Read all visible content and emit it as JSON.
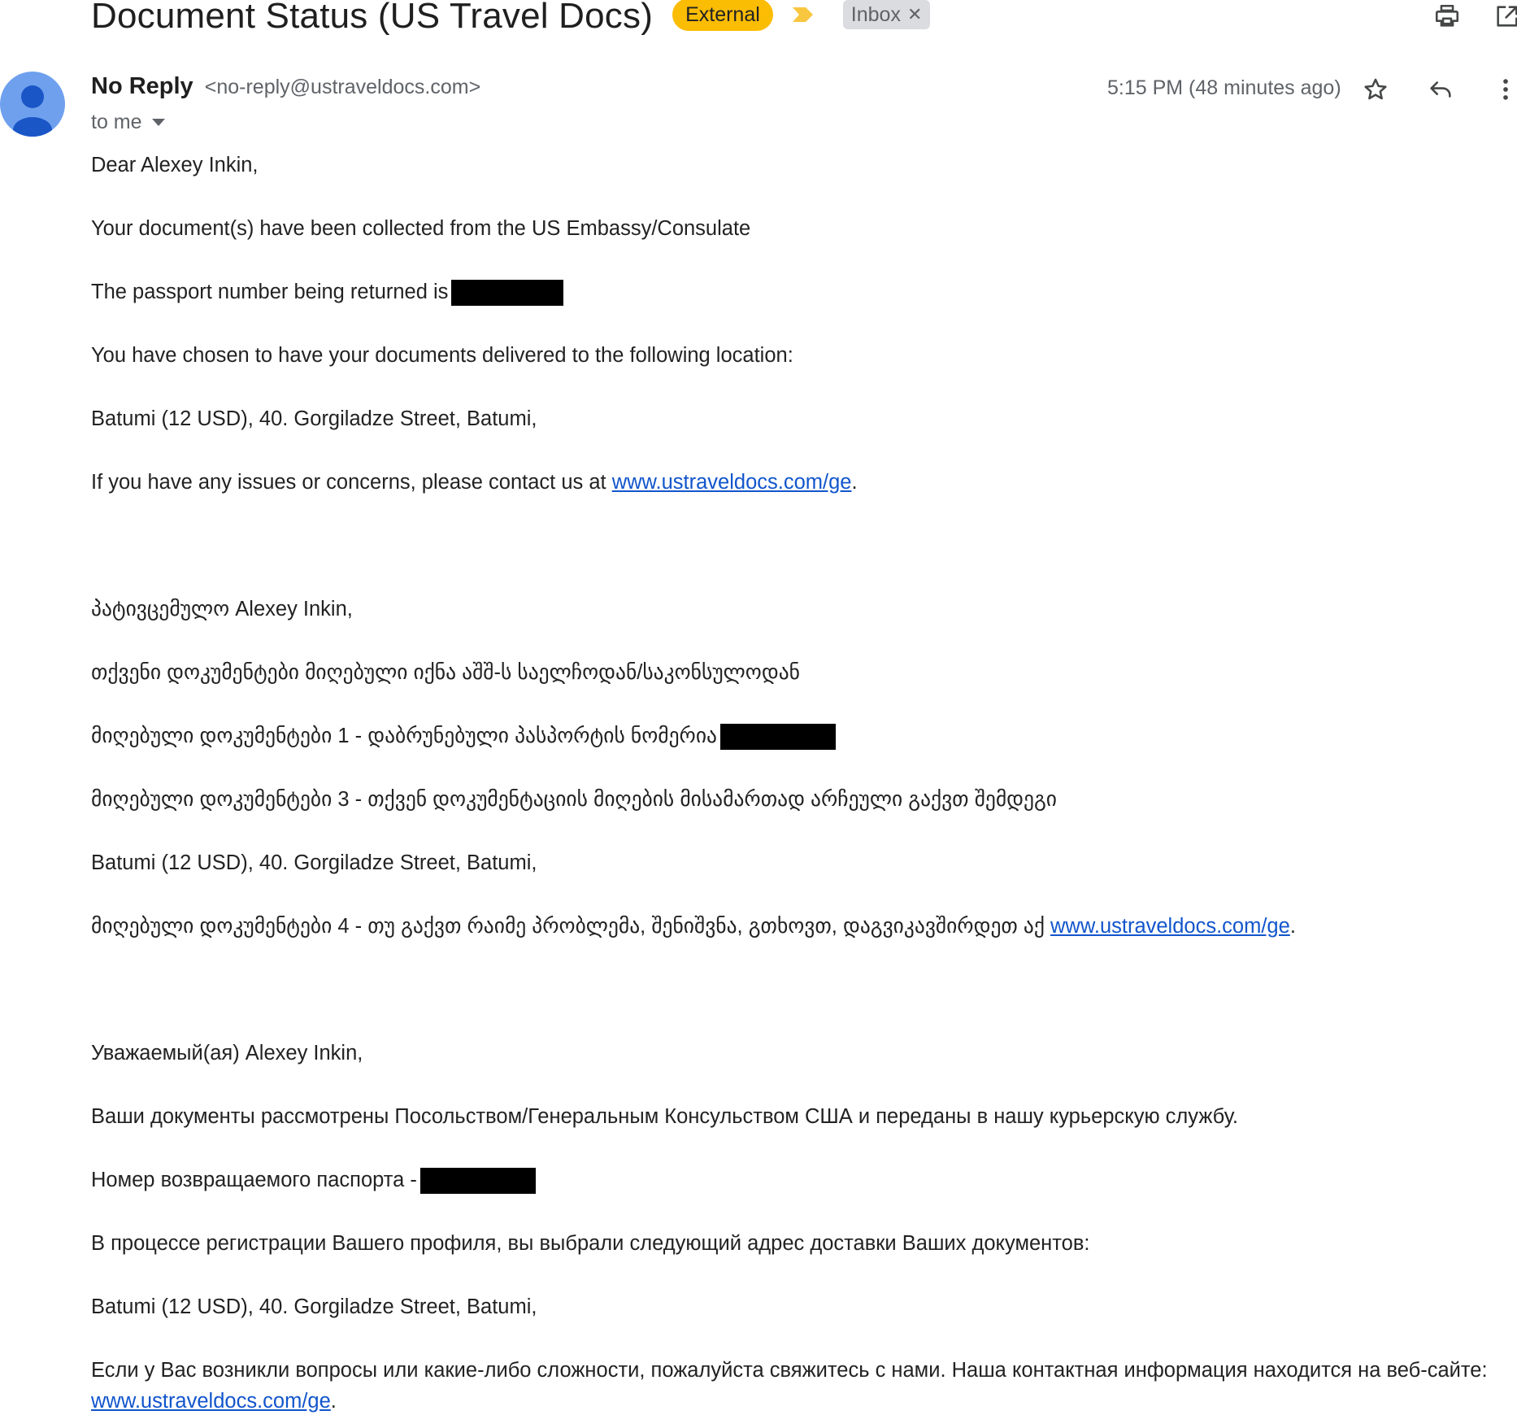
{
  "email": {
    "subject": "Document Status (US Travel Docs)",
    "labels": {
      "external": "External",
      "inbox": "Inbox"
    },
    "sender": {
      "name": "No Reply",
      "email": "<no-reply@ustraveldocs.com>"
    },
    "recipient_line": "to me",
    "timestamp": "5:15 PM (48 minutes ago)"
  },
  "icons": {
    "print": "print-icon",
    "popout": "open-in-new-window-icon",
    "star": "star-icon",
    "reply": "reply-icon",
    "more": "more-vertical-icon",
    "avatar": "default-avatar-icon",
    "importance": "importance-marker-icon",
    "remove_label": "close-icon",
    "expand": "chevron-down-icon"
  },
  "colors": {
    "external_label": "#fbbc04",
    "inbox_label": "#dadce0",
    "link": "#1155cc",
    "avatar": "#6ea0ee",
    "redaction": "#000000"
  },
  "body": {
    "en": {
      "greeting": "Dear Alexey Inkin,",
      "collected": "Your document(s) have been collected from the US Embassy/Consulate",
      "passport": "The passport number being returned is",
      "delivery_intro": "You have chosen to have your documents delivered to the following location:",
      "address": "Batumi (12 USD), 40. Gorgiladze Street, Batumi,",
      "contact_prefix": "If you have any issues or concerns, please contact us at ",
      "contact_link": "www.ustraveldocs.com/ge",
      "contact_suffix": "."
    },
    "ka": {
      "greeting": "პატივცემულო Alexey Inkin,",
      "collected": "თქვენი დოკუმენტები მიღებული იქნა აშშ-ს საელჩოდან/საკონსულოდან",
      "passport": "მიღებული დოკუმენტები 1 - დაბრუნებული პასპორტის ნომერია",
      "delivery_intro": "მიღებული დოკუმენტები 3 - თქვენ დოკუმენტაციის მიღების მისამართად არჩეული გაქვთ შემდეგი",
      "address": "Batumi (12 USD), 40. Gorgiladze Street, Batumi,",
      "contact_prefix": "მიღებული დოკუმენტები 4 - თუ გაქვთ რაიმე პრობლემა, შენიშვნა, გთხოვთ, დაგვიკავშირდეთ აქ ",
      "contact_link": "www.ustraveldocs.com/ge",
      "contact_suffix": "."
    },
    "ru": {
      "greeting": "Уважаемый(ая) Alexey Inkin,",
      "collected": "Ваши документы рассмотрены Посольством/Генеральным Консульством США и переданы в нашу курьерскую службу.",
      "passport": "Номер возвращаемого паспорта -",
      "delivery_intro": "В процессе регистрации Вашего профиля, вы выбрали следующий адрес доставки Ваших документов:",
      "address": "Batumi (12 USD), 40. Gorgiladze Street, Batumi,",
      "contact_line": "Если у Вас возникли вопросы или какие-либо сложности, пожалуйста свяжитесь с нами. Наша контактная информация находится на веб-сайте:",
      "contact_link": "www.ustraveldocs.com/ge",
      "contact_suffix": "."
    }
  }
}
